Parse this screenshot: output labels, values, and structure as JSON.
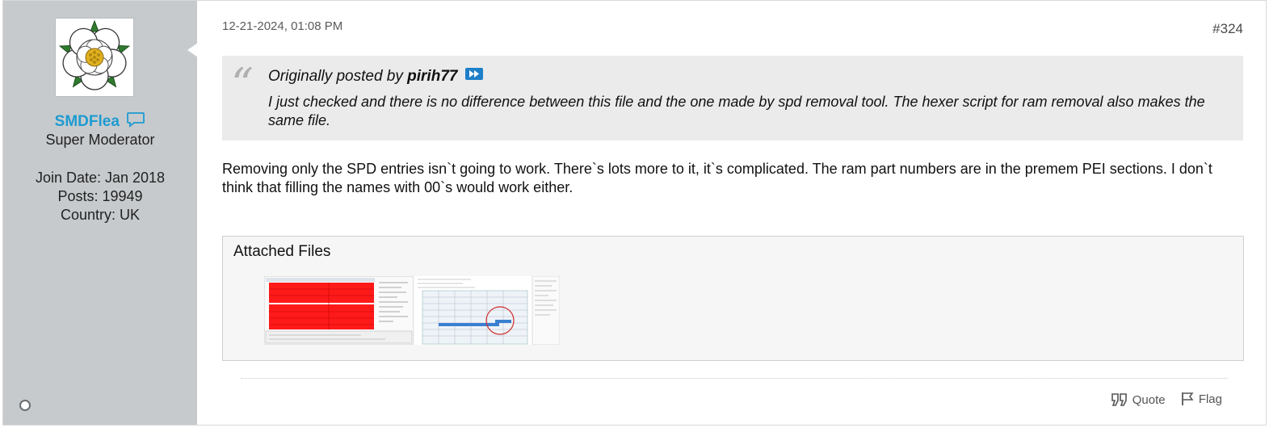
{
  "user": {
    "username": "SMDFlea",
    "title": "Super Moderator",
    "join_date": "Join Date: Jan 2018",
    "posts": "Posts: 19949",
    "country": "Country: UK"
  },
  "post": {
    "date": "12-21-2024, 01:08 PM",
    "number": "#324",
    "quote": {
      "prefix": "Originally posted by",
      "author": "pirih77",
      "text": "I just checked and there is no difference between this file and the one made by spd removal tool. The hexer script for ram removal also makes the same file."
    },
    "content": "Removing only the SPD entries isn`t going to work. There`s lots more to it, it`s complicated. The ram part numbers are in the premem PEI sections. I don`t think that filling the names with 00`s would work either."
  },
  "attachments": {
    "title": "Attached Files",
    "count": 2
  },
  "actions": {
    "quote_label": "Quote",
    "flag_label": "Flag"
  },
  "colors": {
    "username": "#1d9bd1",
    "sidebar": "#c6cacd",
    "quote_bg": "#ebebeb"
  },
  "icons": [
    "private-message-icon",
    "jump-to-post-icon",
    "quote-icon",
    "flag-icon",
    "online-status-icon",
    "avatar-rose"
  ]
}
